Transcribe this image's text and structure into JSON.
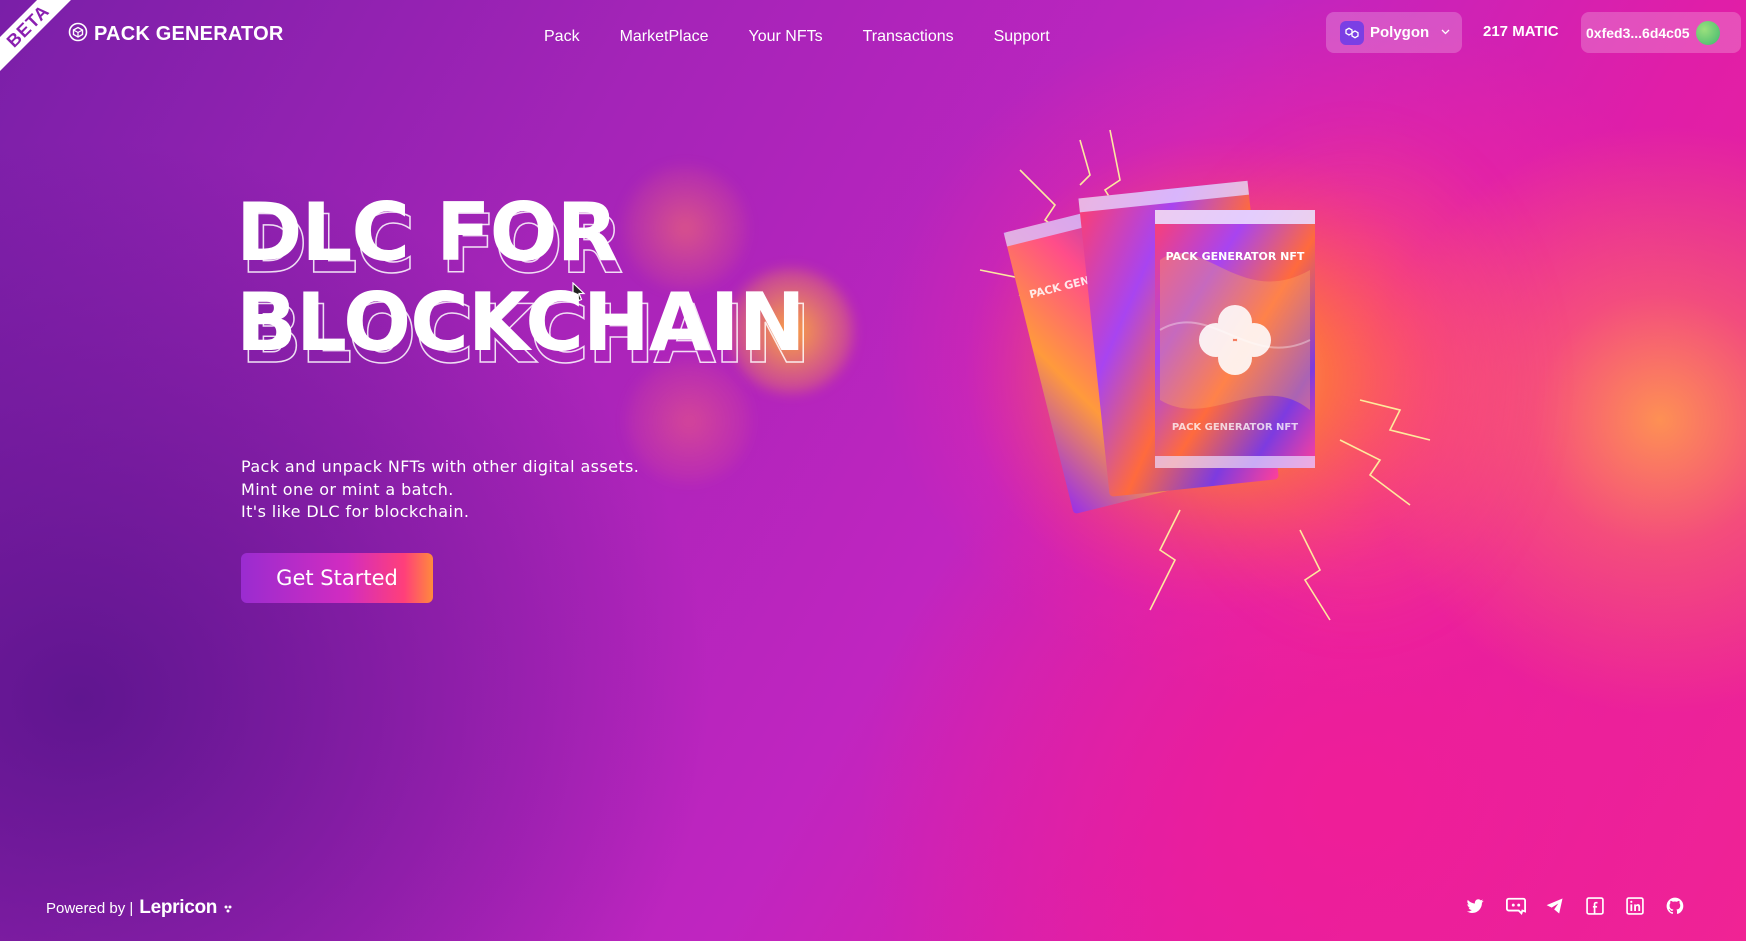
{
  "badge": "BETA",
  "header": {
    "logo_text": "PACK GENERATOR",
    "nav": [
      "Pack",
      "MarketPlace",
      "Your NFTs",
      "Transactions",
      "Support"
    ],
    "network": "Polygon",
    "balance": "217 MATIC",
    "wallet_address": "0xfed3...6d4c05"
  },
  "hero": {
    "title_line1": "DLC FOR",
    "title_line2": "BLOCKCHAIN",
    "description": [
      "Pack and unpack NFTs with other digital assets.",
      "Mint one or mint a batch.",
      "It's like DLC for blockchain."
    ],
    "cta_label": "Get Started",
    "pack_label": "PACK GENERATOR NFT"
  },
  "footer": {
    "powered_by": "Powered by |",
    "brand": "Lepricon",
    "socials": [
      "twitter-icon",
      "discord-icon",
      "telegram-icon",
      "facebook-icon",
      "linkedin-icon",
      "github-icon"
    ]
  },
  "colors": {
    "accent_gradient_start": "#9a2cd0",
    "accent_gradient_end": "#ff8a3c",
    "polygon": "#7b3fe4"
  }
}
